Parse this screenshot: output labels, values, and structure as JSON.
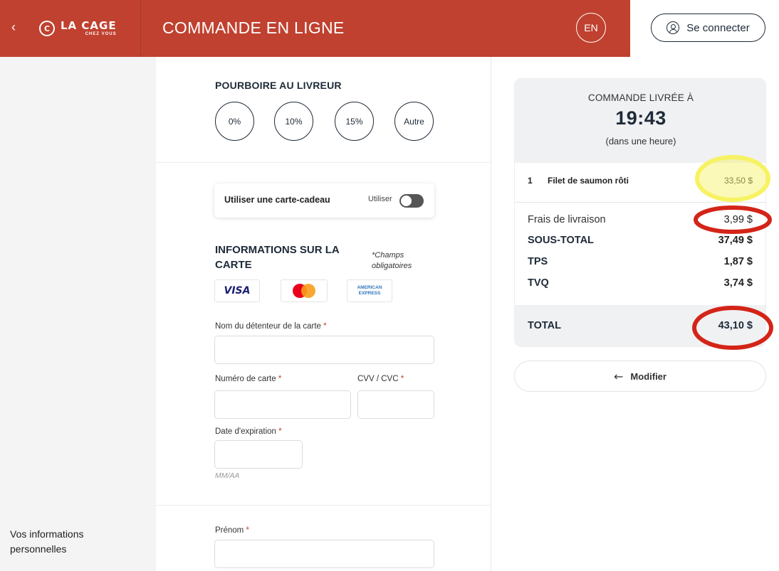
{
  "header": {
    "back_glyph": "‹",
    "logo_mark": "C",
    "logo_main": "LA CAGE",
    "logo_sub": "CHEZ VOUS",
    "title": "COMMANDE EN LIGNE",
    "lang": "EN",
    "login_label": "Se connecter",
    "accent_color": "#c0412f"
  },
  "sidebar": {
    "personal_info_label": "Vos informations personnelles"
  },
  "tip": {
    "title": "POURBOIRE AU LIVREUR",
    "options": [
      "0%",
      "10%",
      "15%",
      "Autre"
    ]
  },
  "gift_card": {
    "label": "Utiliser une carte-cadeau",
    "use_label": "Utiliser",
    "enabled": false
  },
  "card_info": {
    "title": "INFORMATIONS SUR LA CARTE",
    "required_note": "*Champs obligatoires",
    "logos": [
      "VISA",
      "mastercard",
      "AMERICAN EXPRESS"
    ],
    "visa_text": "VISA",
    "amex_line1": "AMERICAN",
    "amex_line2": "EXPRESS",
    "holder_label": "Nom du détenteur de la carte",
    "number_label": "Numéro de carte",
    "cvv_label": "CVV / CVC",
    "expiry_label": "Date d'expiration",
    "expiry_hint": "MM/AA",
    "required_mark": "*",
    "holder_value": "",
    "number_value": "",
    "cvv_value": "",
    "expiry_value": ""
  },
  "personal": {
    "firstname_label": "Prénom",
    "firstname_value": ""
  },
  "summary": {
    "delivered_label": "COMMANDE LIVRÉE À",
    "time": "19:43",
    "time_sub": "(dans une heure)",
    "items": [
      {
        "qty": "1",
        "name": "Filet de saumon rôti",
        "price": "33,50 $"
      }
    ],
    "delivery_label": "Frais de livraison",
    "delivery_value": "3,99 $",
    "subtotal_label": "SOUS-TOTAL",
    "subtotal_value": "37,49 $",
    "tps_label": "TPS",
    "tps_value": "1,87 $",
    "tvq_label": "TVQ",
    "tvq_value": "3,74 $",
    "total_label": "TOTAL",
    "total_value": "43,10 $",
    "modify_label": "Modifier"
  },
  "annotations": {
    "highlight_yellow": "#f7f262",
    "circle_red": "#d42418"
  }
}
